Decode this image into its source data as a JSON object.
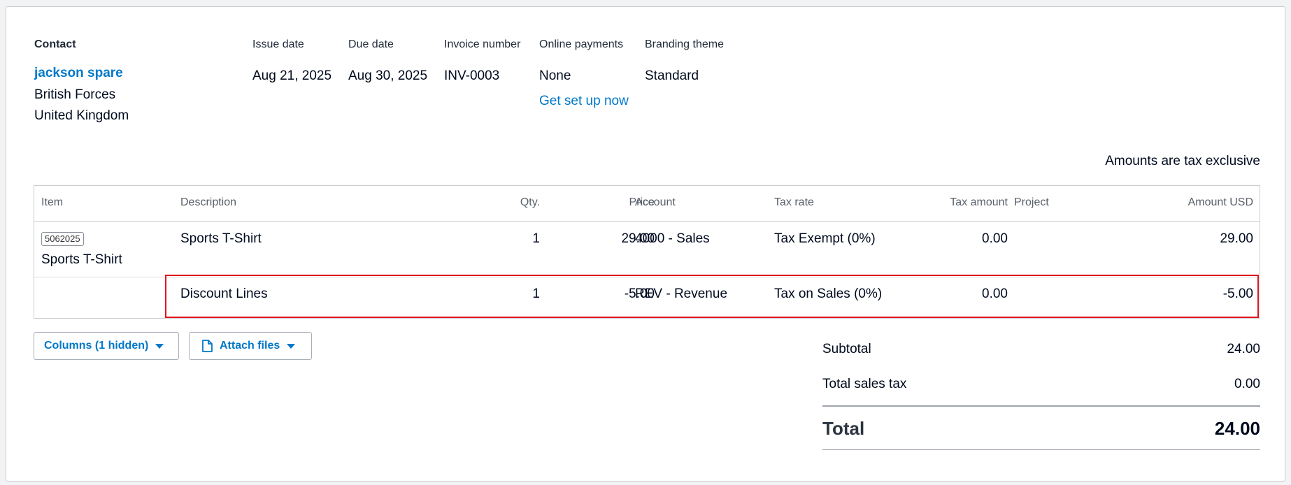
{
  "header": {
    "contact_label": "Contact",
    "contact_name": "jackson spare",
    "contact_line1": "British Forces",
    "contact_line2": "United Kingdom",
    "issue_date_label": "Issue date",
    "issue_date": "Aug 21, 2025",
    "due_date_label": "Due date",
    "due_date": "Aug 30, 2025",
    "invoice_number_label": "Invoice number",
    "invoice_number": "INV-0003",
    "online_payments_label": "Online payments",
    "online_payments_value": "None",
    "online_payments_link": "Get set up now",
    "branding_label": "Branding theme",
    "branding_value": "Standard"
  },
  "amounts_note": "Amounts are tax exclusive",
  "table": {
    "columns": [
      "Item",
      "Description",
      "Qty.",
      "Price",
      "Account",
      "Tax rate",
      "Tax amount",
      "Project",
      "Amount USD"
    ],
    "rows": [
      {
        "item_code": "5062025",
        "item_name": "Sports T-Shirt",
        "description": "Sports T-Shirt",
        "qty": "1",
        "price": "29.00",
        "account": "4000 - Sales",
        "tax_rate": "Tax Exempt (0%)",
        "tax_amount": "0.00",
        "project": "",
        "amount": "29.00"
      },
      {
        "item_code": "",
        "item_name": "",
        "description": "Discount Lines",
        "qty": "1",
        "price": "-5.00",
        "account": "REV - Revenue",
        "tax_rate": "Tax on Sales (0%)",
        "tax_amount": "0.00",
        "project": "",
        "amount": "-5.00"
      }
    ]
  },
  "buttons": {
    "columns_label": "Columns (1 hidden)",
    "attach_label": "Attach files"
  },
  "totals": {
    "subtotal_label": "Subtotal",
    "subtotal": "24.00",
    "tax_label": "Total sales tax",
    "tax": "0.00",
    "total_label": "Total",
    "total": "24.00"
  },
  "colors": {
    "link": "#0078c8",
    "highlight": "#e0141e"
  },
  "icons": [
    "caret-down-icon",
    "document-icon"
  ]
}
